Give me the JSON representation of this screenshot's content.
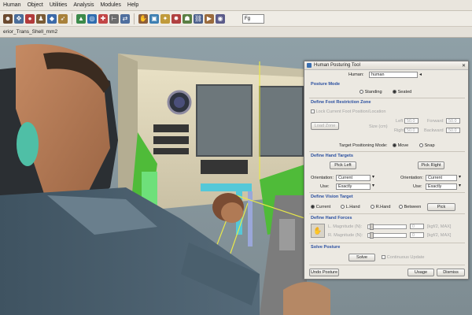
{
  "menubar": {
    "items": [
      "Human",
      "Object",
      "Utilities",
      "Analysis",
      "Modules",
      "Help"
    ]
  },
  "toolbar": {
    "fg_value": "Fg"
  },
  "document": {
    "tab_name": "erior_Trans_Shell_mm2"
  },
  "dialog": {
    "title": "Human Posturing Tool",
    "human_label": "Human:",
    "human_value": "human",
    "posture_mode": {
      "heading": "Posture Mode",
      "options": [
        "Standing",
        "Seated"
      ],
      "selected": "Seated"
    },
    "foot_zone": {
      "heading": "Define Foot Restriction Zone",
      "lock_label": "Lock Current Foot Position/Location",
      "load_zone": "Load Zone",
      "size_label": "Size (cm)",
      "left_label": "Left",
      "left_value": "50.0",
      "right_label": "Right",
      "right_value": "50.0",
      "forward_label": "Forward",
      "forward_value": "50.0",
      "backward_label": "Backward",
      "backward_value": "50.0"
    },
    "target_mode": {
      "label": "Target Positioning Mode:",
      "options": [
        "Move",
        "Snap"
      ],
      "selected": "Move"
    },
    "hand_targets": {
      "heading": "Define Hand Targets",
      "pick_left": "Pick Left",
      "pick_right": "Pick Right",
      "orientation_label": "Orientation:",
      "left_orientation": "Current",
      "right_orientation": "Current",
      "use_label": "Use:",
      "left_use": "Exactly",
      "right_use": "Exactly"
    },
    "vision": {
      "heading": "Define Vision Target",
      "options": [
        "Current",
        "L.Hand",
        "R.Hand",
        "Between"
      ],
      "selected": "Current",
      "pick": "Pick"
    },
    "hand_forces": {
      "heading": "Define Hand Forces",
      "l_magnitude_label": "L. Magnitude (N):",
      "l_value": "0",
      "r_magnitude_label": "R. Magnitude (N):",
      "r_value": "0",
      "range_text": "[kgf/2, MAX]"
    },
    "solve": {
      "heading": "Solve Posture",
      "solve_button": "Solve",
      "continuous_label": "Continuous Update"
    },
    "footer": {
      "undo": "Undo Posture",
      "usage": "Usage",
      "dismiss": "Dismiss"
    }
  },
  "colors": {
    "section_heading": "#2a4fa0",
    "dialog_bg": "#ece9e2"
  }
}
